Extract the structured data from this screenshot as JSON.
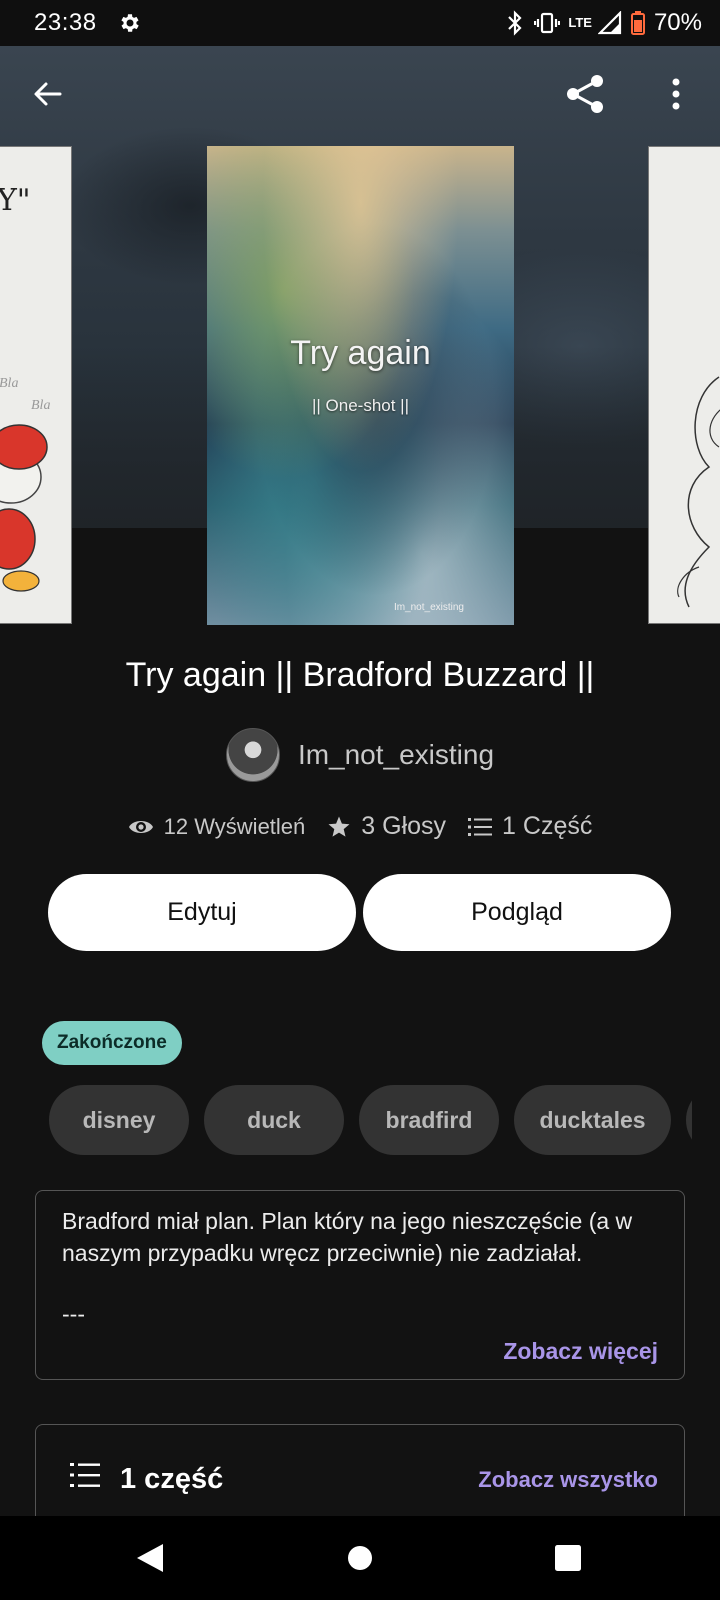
{
  "status_bar": {
    "time": "23:38",
    "network": "LTE",
    "battery": "70%",
    "icons": [
      "gear-icon",
      "bluetooth-icon",
      "vibrate-icon",
      "signal-icon",
      "battery-icon"
    ]
  },
  "toolbar": {
    "icons": [
      "back-arrow-icon",
      "share-icon",
      "more-vertical-icon"
    ]
  },
  "covers": {
    "main": {
      "title": "Try again",
      "subtitle": "|| One-shot ||",
      "author": "Im_not_existing"
    },
    "left": {
      "text": "Y\""
    }
  },
  "story": {
    "title": "Try again || Bradford Buzzard ||",
    "author": "Im_not_existing"
  },
  "stats": {
    "views": "12 Wyświetleń",
    "votes": "3 Głosy",
    "parts": "1 Część"
  },
  "buttons": {
    "edit": "Edytuj",
    "preview": "Podgląd"
  },
  "status_label": "Zakończone",
  "tags": [
    "disney",
    "duck",
    "bradfird",
    "ducktales"
  ],
  "description": {
    "text": "Bradford miał plan. Plan który na jego nieszczęście (a w naszym przypadku wręcz przeciwnie) nie zadziałał.",
    "separator": "---",
    "see_more": "Zobacz więcej"
  },
  "parts_section": {
    "label": "1 część",
    "see_all": "Zobacz wszystko"
  },
  "colors": {
    "background": "#121212",
    "accent": "#a995e8",
    "status_pill": "#7fcfc4",
    "tag": "#333333"
  }
}
